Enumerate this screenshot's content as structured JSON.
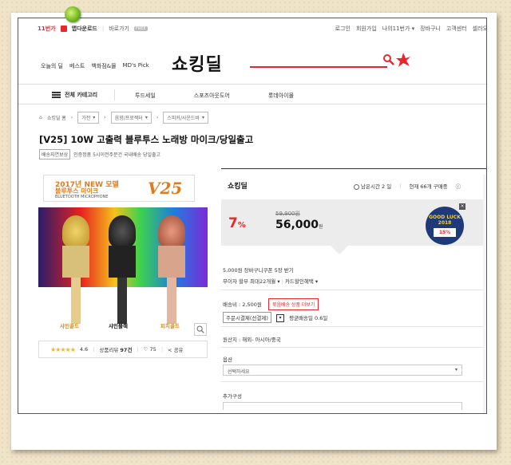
{
  "topbar": {
    "brand": "11번가",
    "app_download": "앱다운로드",
    "bookmark": "바로가기",
    "free": "FREE",
    "links": [
      "로그인",
      "회원가입",
      "나의11번가 ▾",
      "장바구니",
      "고객센터",
      "셀러오"
    ]
  },
  "header": {
    "logo": "쇼킹딜",
    "gnb": [
      "오늘의 딜",
      "베스트",
      "백화점&몰",
      "MD's Pick"
    ]
  },
  "catbar": {
    "all_category": "전체 카테고리",
    "links": [
      "투드세일",
      "스포츠아웃도어",
      "롯데아이몰"
    ]
  },
  "breadcrumb": {
    "home": "쇼킹딜 홈",
    "items": [
      "가전",
      "음향/프로젝터",
      "스피커/사운드바"
    ]
  },
  "product": {
    "title": "[V25] 10W 고출력 블루투스 노래방 마이크/당일출고",
    "badge": "배송지연보상",
    "subtitle": "인증정품 5시이전주문건 국내배송 당일출고",
    "banner_line1": "2017년 NEW 모델",
    "banner_line2": "블루투스 마이크",
    "banner_line3": "BLUETOOTH MICROPHONE",
    "banner_model": "V25",
    "mic_labels": [
      "샤인골드",
      "샤인블랙",
      "피치골드"
    ],
    "rating": "4.6",
    "review_label": "상품리뷰",
    "review_count": "97건",
    "likes": "75",
    "share": "공유",
    "stars": "★★★★★"
  },
  "deal": {
    "logo": "쇼킹딜",
    "remaining": "남은시간 2 일",
    "buyers": "현재 66개 구매중",
    "discount": "7",
    "discount_unit": "%",
    "original_price": "59,900원",
    "price": "56,000",
    "price_unit": "원",
    "goodluck_title": "GOOD LUCK 2018",
    "goodluck_pct": "15%",
    "coupon": "5,000원 장바구니쿠폰 5장 받기",
    "installment": "무이자 할부 최대22개월",
    "card_benefit": "카드할인혜택",
    "shipping_fee": "배송비 : 2,500원",
    "free_ship_btn": "묶음배송 상품 더보기",
    "payment_option": "주문시결제(선결제)",
    "avg_delivery": "평균배송일 0.6일",
    "origin": "원산지 : 해외- 아시아/중국",
    "option_label": "옵션",
    "option_placeholder": "선택하세요",
    "extra_label": "추가구성"
  }
}
